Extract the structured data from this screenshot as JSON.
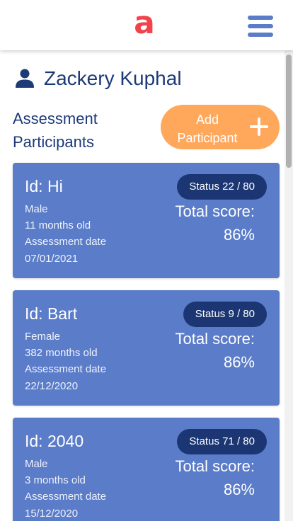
{
  "header": {
    "logo_text": "a",
    "menu_icon": "hamburger-menu-icon"
  },
  "user": {
    "name": "Zackery Kuphal",
    "icon": "user-icon"
  },
  "section": {
    "title": "Assessment Participants"
  },
  "add_button": {
    "label": "Add Participant",
    "icon": "plus-icon"
  },
  "participants": [
    {
      "id_label": "Id: Hi",
      "gender": "Male",
      "age": "11 months old",
      "date_label": "Assessment date",
      "date": "07/01/2021",
      "status": "Status 22 / 80",
      "total_label": "Total score:",
      "score": "86%"
    },
    {
      "id_label": "Id: Bart",
      "gender": "Female",
      "age": "382 months old",
      "date_label": "Assessment date",
      "date": "22/12/2020",
      "status": "Status 9 / 80",
      "total_label": "Total score:",
      "score": "86%"
    },
    {
      "id_label": "Id: 2040",
      "gender": "Male",
      "age": "3 months old",
      "date_label": "Assessment date",
      "date": "15/12/2020",
      "status": "Status 71 / 80",
      "total_label": "Total score:",
      "score": "86%"
    }
  ],
  "colors": {
    "brand_red": "#f2424a",
    "card_blue": "#5a7cc9",
    "navy": "#1b3673",
    "title_navy": "#1d3a78",
    "accent_orange": "#ffa85c"
  }
}
